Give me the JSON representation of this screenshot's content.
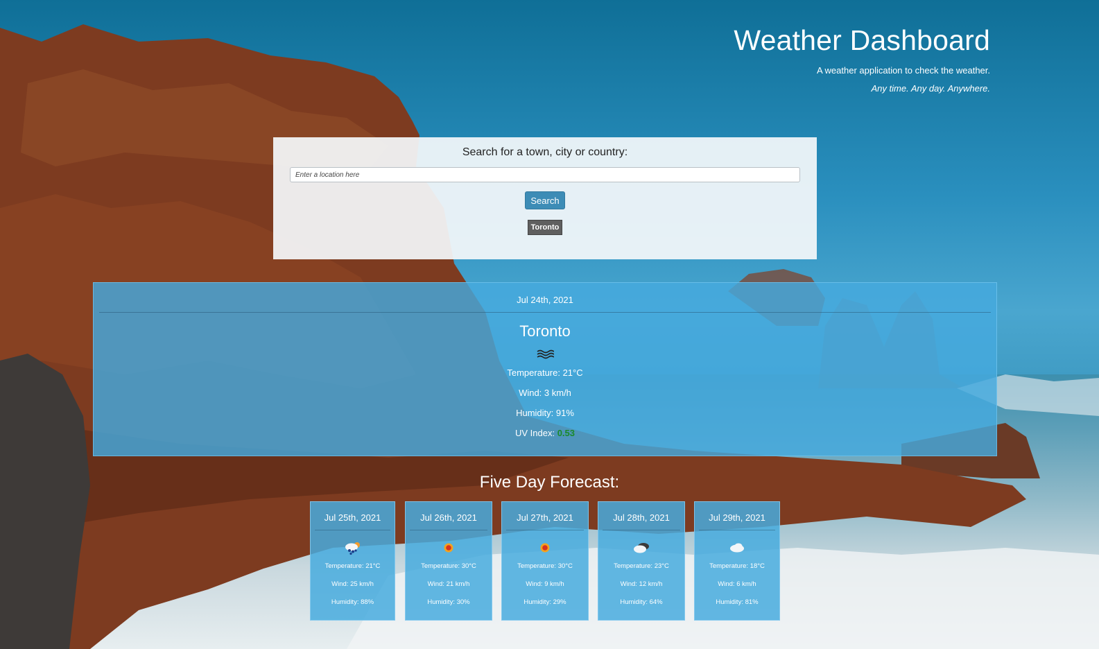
{
  "header": {
    "title": "Weather Dashboard",
    "tagline": "A weather application to check the weather.",
    "tagline_italic": "Any time. Any day. Anywhere."
  },
  "search": {
    "label": "Search for a town, city or country:",
    "placeholder": "Enter a location here",
    "button_label": "Search",
    "history": [
      "Toronto"
    ]
  },
  "current": {
    "date": "Jul 24th, 2021",
    "city": "Toronto",
    "icon": "mist-icon",
    "temperature": "Temperature: 21°C",
    "wind": "Wind: 3 km/h",
    "humidity": "Humidity: 91%",
    "uv_label": "UV Index: ",
    "uv_value": "0.53",
    "uv_color": "#1a8a2a"
  },
  "forecast": {
    "title": "Five Day Forecast:",
    "days": [
      {
        "date": "Jul 25th, 2021",
        "icon": "thunder-rain-icon",
        "temperature": "Temperature: 21°C",
        "wind": "Wind: 25 km/h",
        "humidity": "Humidity: 88%"
      },
      {
        "date": "Jul 26th, 2021",
        "icon": "sun-icon",
        "temperature": "Temperature: 30°C",
        "wind": "Wind: 21 km/h",
        "humidity": "Humidity: 30%"
      },
      {
        "date": "Jul 27th, 2021",
        "icon": "sun-icon",
        "temperature": "Temperature: 30°C",
        "wind": "Wind: 9 km/h",
        "humidity": "Humidity: 29%"
      },
      {
        "date": "Jul 28th, 2021",
        "icon": "broken-clouds-icon",
        "temperature": "Temperature: 23°C",
        "wind": "Wind: 12 km/h",
        "humidity": "Humidity: 64%"
      },
      {
        "date": "Jul 29th, 2021",
        "icon": "cloud-icon",
        "temperature": "Temperature: 18°C",
        "wind": "Wind: 6 km/h",
        "humidity": "Humidity: 81%"
      }
    ]
  },
  "colors": {
    "accent": "#3d8cb6",
    "panel": "#46aade",
    "history_button": "#5f5f5f"
  }
}
